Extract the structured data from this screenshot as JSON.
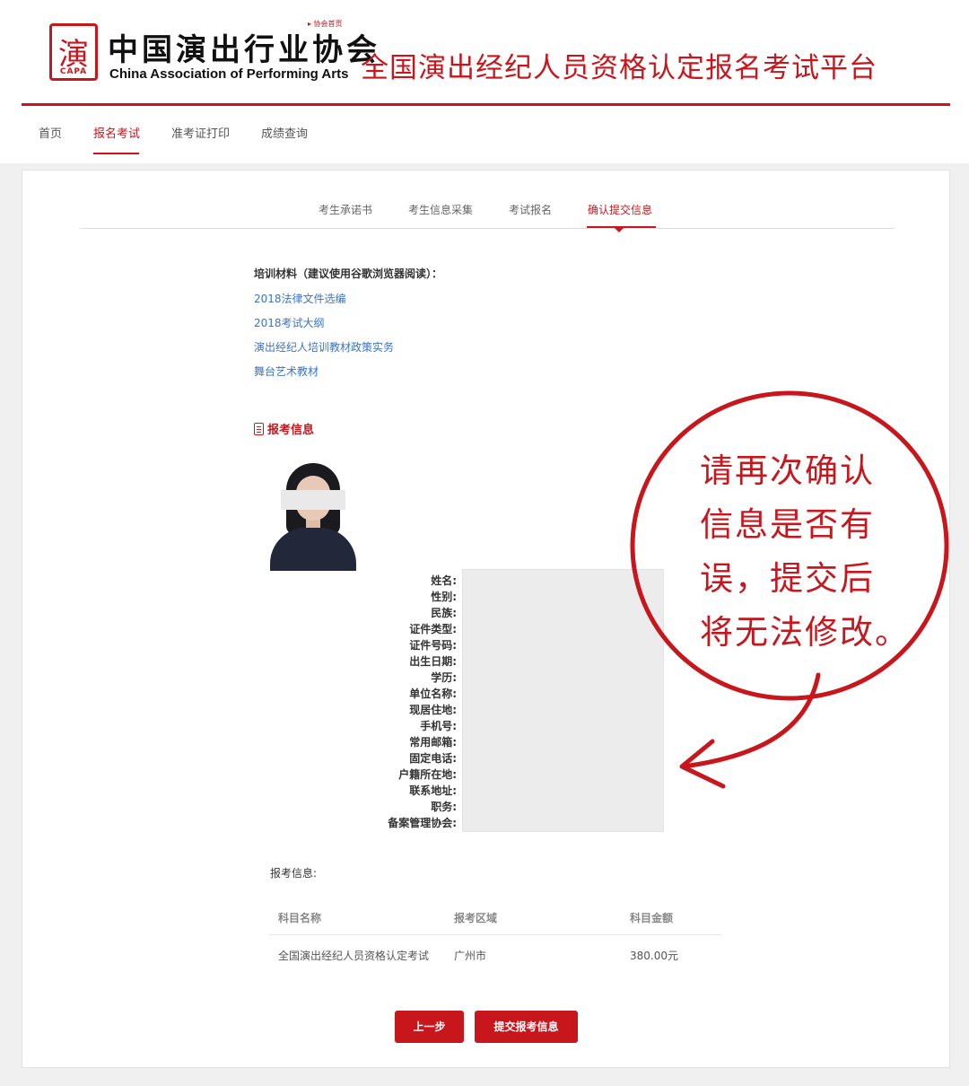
{
  "header": {
    "seal_glyph": "演",
    "seal_caption": "CAPA",
    "org_name_cn": "中国演出行业协会",
    "org_name_en": "China Association of Performing Arts",
    "home_link": "▸ 协会首页",
    "platform_title": "全国演出经纪人员资格认定报名考试平台"
  },
  "nav": {
    "items": [
      {
        "label": "首页"
      },
      {
        "label": "报名考试",
        "active": true
      },
      {
        "label": "准考证打印"
      },
      {
        "label": "成绩查询"
      }
    ]
  },
  "steps": [
    {
      "label": "考生承诺书"
    },
    {
      "label": "考生信息采集"
    },
    {
      "label": "考试报名"
    },
    {
      "label": "确认提交信息",
      "active": true
    }
  ],
  "materials": {
    "title": "培训材料（建议使用谷歌浏览器阅读）：",
    "links": [
      {
        "label": "2018法律文件选编"
      },
      {
        "label": "2018考试大纲"
      },
      {
        "label": "演出经纪人培训教材政策实务"
      },
      {
        "label": "舞台艺术教材"
      }
    ]
  },
  "info": {
    "section_title": "报考信息",
    "fields": [
      "姓名:",
      "性别:",
      "民族:",
      "证件类型:",
      "证件号码:",
      "出生日期:",
      "学历:",
      "单位名称:",
      "现居住地:",
      "手机号:",
      "常用邮箱:",
      "固定电话:",
      "户籍所在地:",
      "联系地址:",
      "职务:",
      "备案管理协会:"
    ]
  },
  "exam": {
    "label": "报考信息:",
    "columns": [
      "科目名称",
      "报考区域",
      "科目金额"
    ],
    "rows": [
      {
        "subject": "全国演出经纪人员资格认定考试",
        "region": "广州市",
        "fee": "380.00元"
      }
    ]
  },
  "buttons": {
    "prev": "上一步",
    "submit": "提交报考信息"
  },
  "annotation": {
    "lines": [
      "请再次确认",
      "信息是否有",
      "误，提交后",
      "将无法修改。"
    ],
    "color": "#c8161d"
  },
  "theme": {
    "accent": "#c8161d",
    "link": "#3c73c5"
  }
}
